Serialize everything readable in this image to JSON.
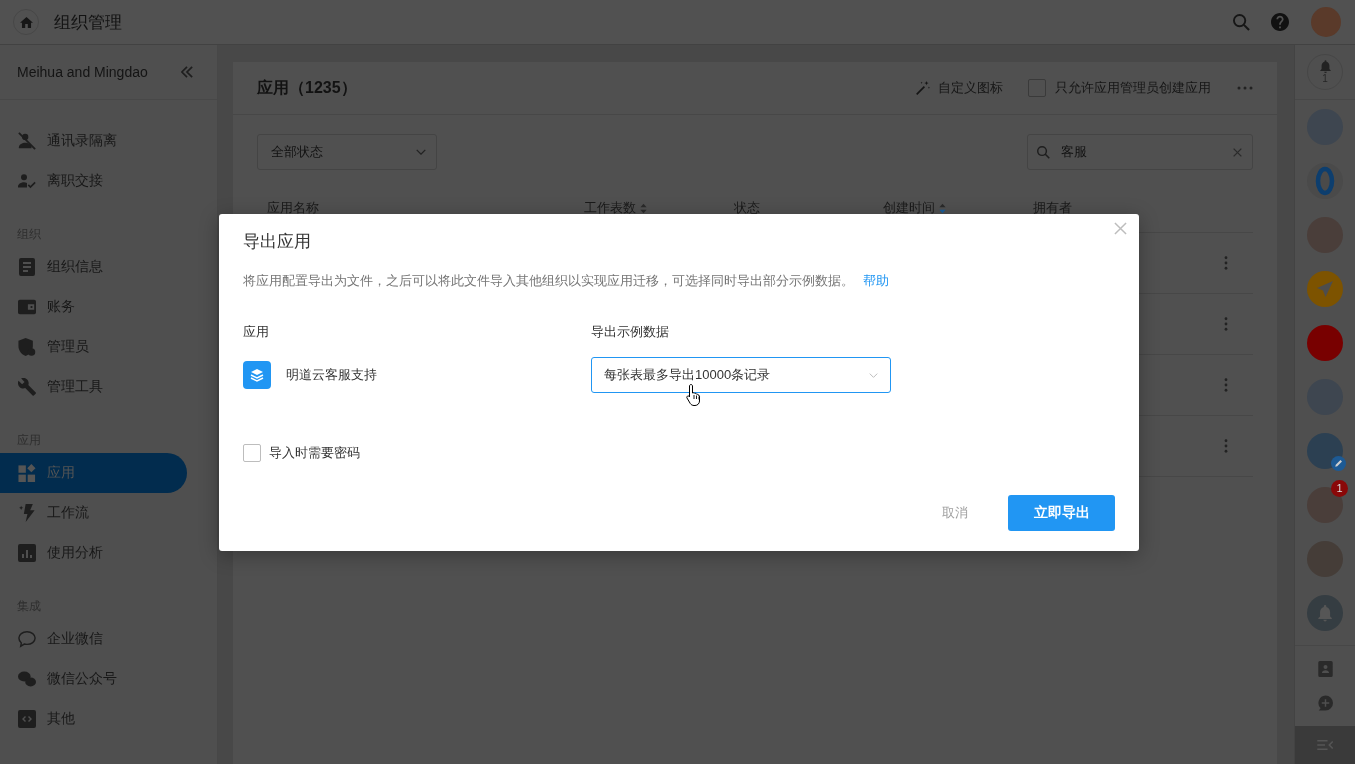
{
  "header": {
    "title": "组织管理"
  },
  "sidebar": {
    "org_name": "Meihua and Mingdao",
    "sections": [
      {
        "items": [
          {
            "label": "通讯录隔离",
            "selected": false
          },
          {
            "label": "离职交接",
            "selected": false
          }
        ]
      },
      {
        "title": "组织",
        "items": [
          {
            "label": "组织信息",
            "selected": false
          },
          {
            "label": "账务",
            "selected": false
          },
          {
            "label": "管理员",
            "selected": false
          },
          {
            "label": "管理工具",
            "selected": false
          }
        ]
      },
      {
        "title": "应用",
        "items": [
          {
            "label": "应用",
            "selected": true
          },
          {
            "label": "工作流",
            "selected": false
          },
          {
            "label": "使用分析",
            "selected": false
          }
        ]
      },
      {
        "title": "集成",
        "items": [
          {
            "label": "企业微信",
            "selected": false
          },
          {
            "label": "微信公众号",
            "selected": false
          },
          {
            "label": "其他",
            "selected": false
          }
        ]
      }
    ]
  },
  "apps_card": {
    "title": "应用（1235）",
    "custom_icon": "自定义图标",
    "admin_only": {
      "label": "只允许应用管理员创建应用",
      "checked": false
    },
    "status_filter": {
      "value": "全部状态"
    },
    "search": {
      "value": "客服"
    },
    "table": {
      "columns": [
        {
          "label": "应用名称",
          "sortable": false
        },
        {
          "label": "工作表数",
          "sortable": true,
          "sorted_desc": false
        },
        {
          "label": "状态",
          "sortable": false
        },
        {
          "label": "创建时间",
          "sortable": true,
          "sorted_desc": true
        },
        {
          "label": "拥有者",
          "sortable": false
        }
      ]
    }
  },
  "chat_bar": {
    "notification": {
      "count": "1"
    },
    "items": [
      {
        "kind": "avatar"
      },
      {
        "kind": "logo"
      },
      {
        "kind": "avatar"
      },
      {
        "kind": "send",
        "color": "#7d5300"
      },
      {
        "kind": "plain",
        "color": "#780000"
      },
      {
        "kind": "photo",
        "edit_badge": false
      },
      {
        "kind": "photo",
        "edit_badge": true
      },
      {
        "kind": "photo",
        "edit_badge": false,
        "badge": "1"
      },
      {
        "kind": "photo",
        "edit_badge": false
      },
      {
        "kind": "bell"
      }
    ]
  },
  "export_dialog": {
    "title": "导出应用",
    "description": "将应用配置导出为文件，之后可以将此文件导入其他组织以实现应用迁移，可选择同时导出部分示例数据。",
    "help_link": "帮助",
    "app_column": "应用",
    "data_column": "导出示例数据",
    "app_name": "明道云客服支持",
    "data_select": {
      "value": "每张表最多导出10000条记录",
      "focused": true
    },
    "password_option": {
      "label": "导入时需要密码",
      "checked": false
    },
    "cancel_button": "取消",
    "export_button": "立即导出"
  }
}
